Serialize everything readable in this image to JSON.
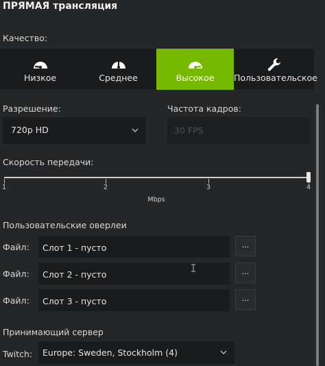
{
  "header": {
    "title": "ПРЯМАЯ трансляция"
  },
  "quality": {
    "label": "Качество:",
    "options": [
      {
        "label": "Низкое",
        "icon": "gauge-low-icon",
        "active": false
      },
      {
        "label": "Среднее",
        "icon": "gauge-medium-icon",
        "active": false
      },
      {
        "label": "Высокое",
        "icon": "gauge-high-icon",
        "active": true
      },
      {
        "label": "Пользовательское",
        "icon": "wrench-icon",
        "active": false
      }
    ]
  },
  "resolution": {
    "label": "Разрешение:",
    "value": "720p HD"
  },
  "framerate": {
    "label": "Частота кадров:",
    "value": "30 FPS"
  },
  "bitrate": {
    "label": "Скорость передачи:",
    "ticks": [
      "1",
      "2",
      "3",
      "4"
    ],
    "unit": "Mbps",
    "value": 4,
    "min": 1,
    "max": 4
  },
  "overlays": {
    "label": "Пользовательские оверлеи",
    "slots": [
      {
        "label": "Файл:",
        "value": "Слот 1 - пусто",
        "browse": "..."
      },
      {
        "label": "Файл:",
        "value": "Слот 2 - пусто",
        "browse": "..."
      },
      {
        "label": "Файл:",
        "value": "Слот 3 - пусто",
        "browse": "..."
      }
    ]
  },
  "server": {
    "label": "Принимающий сервер",
    "service_label": "Twitch:",
    "value": "Europe: Sweden, Stockholm (4)"
  },
  "colors": {
    "accent": "#76b900",
    "background": "#252627",
    "control": "#1a1b1c"
  }
}
